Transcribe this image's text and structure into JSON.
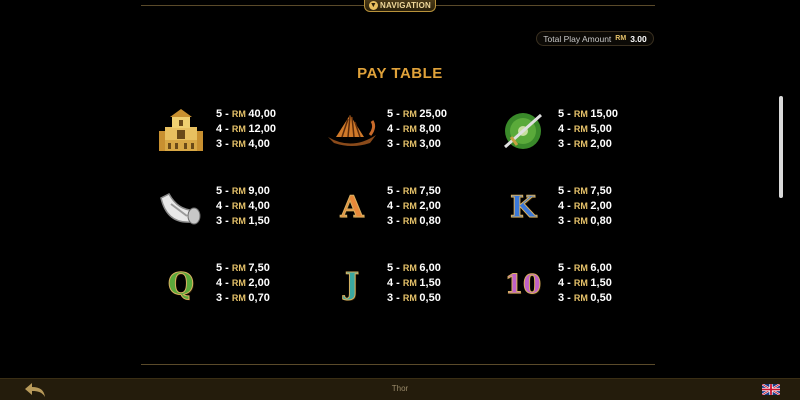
{
  "nav": {
    "label": "NAVIGATION"
  },
  "play_amount": {
    "label": "Total Play Amount",
    "currency": "RM",
    "value": "3.00"
  },
  "title": "PAY TABLE",
  "symbols": [
    {
      "icon": "palace-icon",
      "pays": [
        {
          "n": "5",
          "value": "40,00"
        },
        {
          "n": "4",
          "value": "12,00"
        },
        {
          "n": "3",
          "value": "4,00"
        }
      ]
    },
    {
      "icon": "viking-ship-icon",
      "pays": [
        {
          "n": "5",
          "value": "25,00"
        },
        {
          "n": "4",
          "value": "8,00"
        },
        {
          "n": "3",
          "value": "3,00"
        }
      ]
    },
    {
      "icon": "sword-shield-icon",
      "pays": [
        {
          "n": "5",
          "value": "15,00"
        },
        {
          "n": "4",
          "value": "5,00"
        },
        {
          "n": "3",
          "value": "2,00"
        }
      ]
    },
    {
      "icon": "drinking-horn-icon",
      "pays": [
        {
          "n": "5",
          "value": "9,00"
        },
        {
          "n": "4",
          "value": "4,00"
        },
        {
          "n": "3",
          "value": "1,50"
        }
      ]
    },
    {
      "icon": "letter-a-icon",
      "letter": "A",
      "color": "#e8893a",
      "pays": [
        {
          "n": "5",
          "value": "7,50"
        },
        {
          "n": "4",
          "value": "2,00"
        },
        {
          "n": "3",
          "value": "0,80"
        }
      ]
    },
    {
      "icon": "letter-k-icon",
      "letter": "K",
      "color": "#3a78d8",
      "pays": [
        {
          "n": "5",
          "value": "7,50"
        },
        {
          "n": "4",
          "value": "2,00"
        },
        {
          "n": "3",
          "value": "0,80"
        }
      ]
    },
    {
      "icon": "letter-q-icon",
      "letter": "Q",
      "color": "#5aa83a",
      "pays": [
        {
          "n": "5",
          "value": "7,50"
        },
        {
          "n": "4",
          "value": "2,00"
        },
        {
          "n": "3",
          "value": "0,70"
        }
      ]
    },
    {
      "icon": "letter-j-icon",
      "letter": "J",
      "color": "#3aa8a0",
      "pays": [
        {
          "n": "5",
          "value": "6,00"
        },
        {
          "n": "4",
          "value": "1,50"
        },
        {
          "n": "3",
          "value": "0,50"
        }
      ]
    },
    {
      "icon": "number-10-icon",
      "letter": "10",
      "color": "#c060c8",
      "pays": [
        {
          "n": "5",
          "value": "6,00"
        },
        {
          "n": "4",
          "value": "1,50"
        },
        {
          "n": "3",
          "value": "0,50"
        }
      ]
    }
  ],
  "separator": "-",
  "currency": "RM",
  "footer": {
    "game_name": "Thor",
    "back_icon": "back-arrow-icon",
    "language_icon": "uk-flag-icon"
  }
}
